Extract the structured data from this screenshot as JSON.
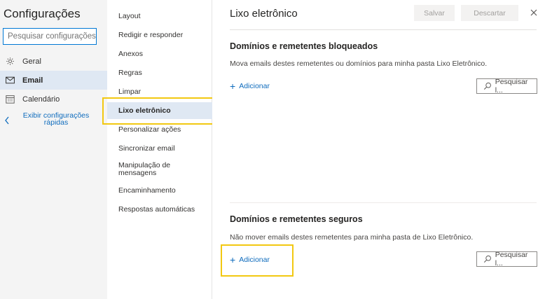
{
  "left": {
    "title": "Configurações",
    "search_placeholder": "Pesquisar configurações",
    "nav": [
      {
        "label": "Geral",
        "icon": "gear-icon"
      },
      {
        "label": "Email",
        "icon": "mail-icon"
      },
      {
        "label": "Calendário",
        "icon": "calendar-icon"
      }
    ],
    "quick_settings": "Exibir configurações rápidas"
  },
  "middle": {
    "items": [
      "Layout",
      "Redigir e responder",
      "Anexos",
      "Regras",
      "Limpar",
      "Lixo eletrônico",
      "Personalizar ações",
      "Sincronizar email",
      "Manipulação de mensagens",
      "Encaminhamento",
      "Respostas automáticas"
    ],
    "selected": "Lixo eletrônico"
  },
  "right": {
    "title": "Lixo eletrônico",
    "save_label": "Salvar",
    "discard_label": "Descartar",
    "blocked": {
      "title": "Domínios e remetentes bloqueados",
      "desc": "Mova emails destes remetentes ou domínios para minha pasta Lixo Eletrônico.",
      "add_label": "Adicionar",
      "search_label": "Pesquisar l..."
    },
    "safe": {
      "title": "Domínios e remetentes seguros",
      "desc": "Não mover emails destes remetentes para minha pasta de Lixo Eletrônico.",
      "add_label": "Adicionar",
      "search_label": "Pesquisar l..."
    }
  },
  "colors": {
    "accent": "#0f6cbd",
    "highlight": "#f2c811",
    "selected_bg": "#dfe8f3",
    "sidebar_bg": "#f4f4f4"
  }
}
